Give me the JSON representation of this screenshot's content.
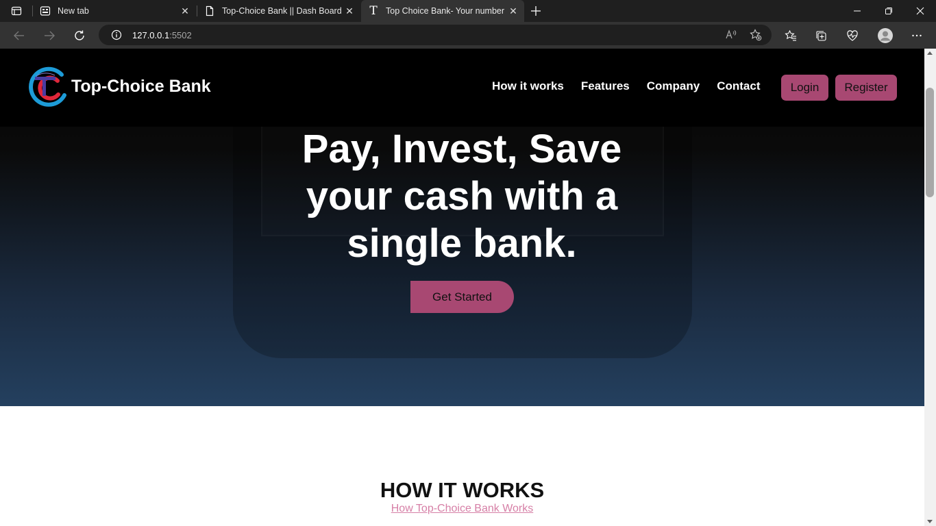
{
  "browser": {
    "tabs": [
      {
        "title": "New tab"
      },
      {
        "title": "Top-Choice Bank || Dash Board"
      },
      {
        "title": "Top Choice Bank- Your number c",
        "favicon_letter": "T"
      }
    ],
    "url_host": "127.0.0.1",
    "url_port": ":5502"
  },
  "site": {
    "brand": "Top-Choice Bank",
    "nav": [
      "How it works",
      "Features",
      "Company",
      "Contact"
    ],
    "login_label": "Login",
    "register_label": "Register"
  },
  "hero": {
    "title": "Pay, Invest, Save your cash with a single bank.",
    "cta_label": "Get Started"
  },
  "how_it_works": {
    "title": "HOW IT WORKS",
    "subtitle": "How Top-Choice Bank Works"
  },
  "colors": {
    "accent": "#a84872",
    "link": "#d67fa6",
    "nav_bg": "#000000",
    "hero_bottom": "#24405f"
  },
  "icons": [
    "tab-actions-icon",
    "new-tab-page-icon",
    "document-icon",
    "close-icon",
    "plus-icon",
    "minimize-icon",
    "restore-icon",
    "back-arrow-icon",
    "forward-arrow-icon",
    "refresh-icon",
    "info-icon",
    "read-aloud-icon",
    "add-favorite-icon",
    "favorites-icon",
    "collections-icon",
    "browser-essentials-icon",
    "profile-icon",
    "more-icon"
  ]
}
